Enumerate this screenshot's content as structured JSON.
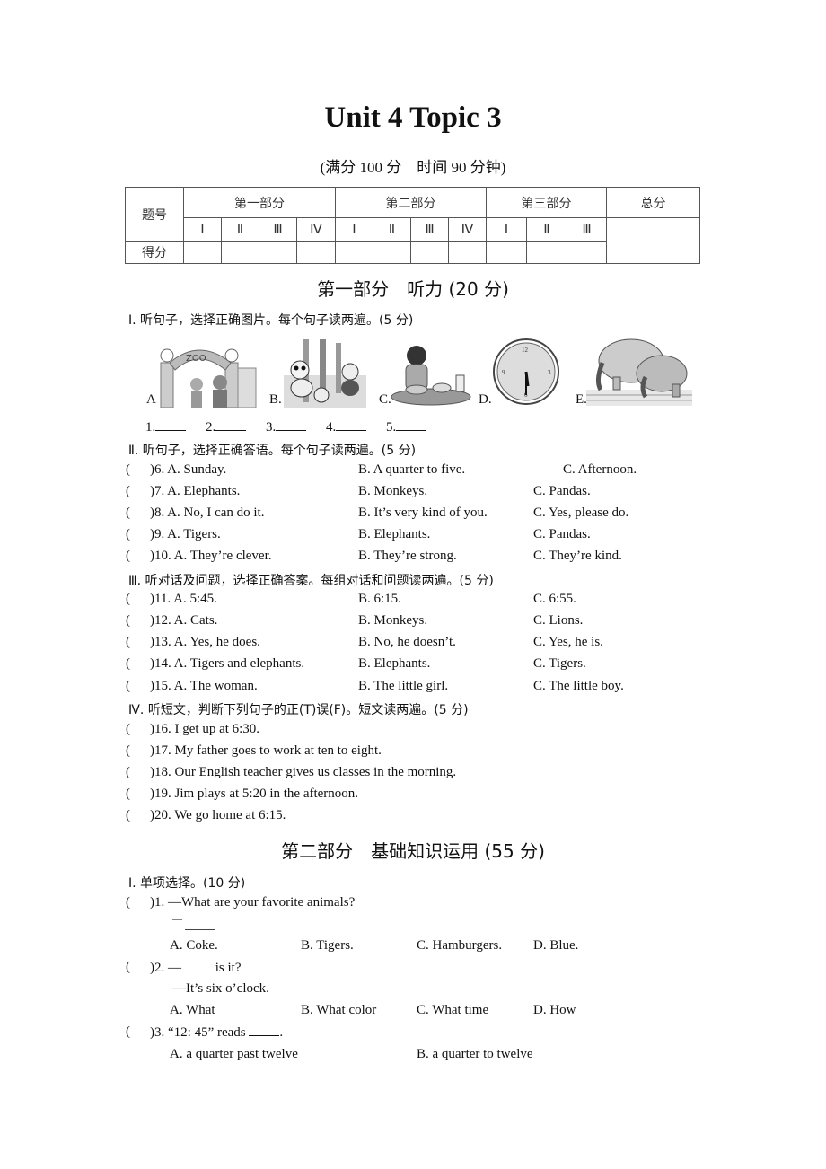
{
  "title": "Unit 4 Topic 3",
  "subtitle": "(满分 100 分　时间 90 分钟)",
  "score_table": {
    "row_header_label": "题号",
    "score_label": "得分",
    "total_label": "总分",
    "parts": [
      {
        "label": "第一部分",
        "columns": [
          "Ⅰ",
          "Ⅱ",
          "Ⅲ",
          "Ⅳ"
        ]
      },
      {
        "label": "第二部分",
        "columns": [
          "Ⅰ",
          "Ⅱ",
          "Ⅲ",
          "Ⅳ"
        ]
      },
      {
        "label": "第三部分",
        "columns": [
          "Ⅰ",
          "Ⅱ",
          "Ⅲ"
        ]
      }
    ]
  },
  "part1": {
    "heading": "第一部分　听力 (20 分)",
    "section1": {
      "instruction": "Ⅰ. 听句子，选择正确图片。每个句子读两遍。(5 分)",
      "pictures": [
        {
          "label": "A.",
          "icon": "zoo-gate-picture"
        },
        {
          "label": "B.",
          "icon": "pandas-picture"
        },
        {
          "label": "C.",
          "icon": "boy-eating-picture"
        },
        {
          "label": "D.",
          "icon": "clock-picture"
        },
        {
          "label": "E.",
          "icon": "elephants-picture"
        }
      ],
      "answer_blanks": [
        "1.",
        "2.",
        "3.",
        "4.",
        "5."
      ]
    },
    "section2": {
      "instruction": "Ⅱ. 听句子，选择正确答语。每个句子读两遍。(5 分)",
      "questions": [
        {
          "num": ")6. A. Sunday.",
          "b": "B. A quarter to five.",
          "c": "C. Afternoon."
        },
        {
          "num": ")7. A. Elephants.",
          "b": "B. Monkeys.",
          "c": "C. Pandas."
        },
        {
          "num": ")8. A. No, I can do it.",
          "b": "B. It’s very kind of you.",
          "c": "C. Yes, please do."
        },
        {
          "num": ")9. A. Tigers.",
          "b": "B. Elephants.",
          "c": "C. Pandas."
        },
        {
          "num": ")10. A. They’re clever.",
          "b": "B. They’re strong.",
          "c": "C. They’re kind."
        }
      ]
    },
    "section3": {
      "instruction": "Ⅲ. 听对话及问题，选择正确答案。每组对话和问题读两遍。(5 分)",
      "questions": [
        {
          "num": ")11. A. 5:45.",
          "b": "B. 6:15.",
          "c": "C. 6:55."
        },
        {
          "num": ")12. A. Cats.",
          "b": "B. Monkeys.",
          "c": "C. Lions."
        },
        {
          "num": ")13. A. Yes, he does.",
          "b": "B. No, he doesn’t.",
          "c": "C. Yes, he is."
        },
        {
          "num": ")14. A. Tigers and elephants.",
          "b": "B. Elephants.",
          "c": "C. Tigers."
        },
        {
          "num": ")15. A. The woman.",
          "b": "B. The little girl.",
          "c": "C. The little boy."
        }
      ]
    },
    "section4": {
      "instruction": "Ⅳ. 听短文，判断下列句子的正(T)误(F)。短文读两遍。(5 分)",
      "statements": [
        ")16. I get up at 6:30.",
        ")17. My father goes to work at ten to eight.",
        ")18. Our English teacher gives us classes in the morning.",
        ")19. Jim plays at 5:20 in the afternoon.",
        ")20. We go home at 6:15."
      ]
    }
  },
  "part2": {
    "heading": "第二部分　基础知识运用 (55 分)",
    "section1": {
      "instruction": "Ⅰ. 单项选择。(10 分)",
      "q1": {
        "stem": ")1. —What are your favorite animals?",
        "reply": "—",
        "options": [
          "A. Coke.",
          "B. Tigers.",
          "C. Hamburgers.",
          "D. Blue."
        ]
      },
      "q2": {
        "stem_prefix": ")2. —",
        "stem_suffix": " is it?",
        "reply": "—It’s six o’clock.",
        "options": [
          "A. What",
          "B. What color",
          "C. What time",
          "D. How"
        ]
      },
      "q3": {
        "stem_prefix": ")3. “12: 45” reads ",
        "stem_suffix": ".",
        "options": [
          "A. a quarter past twelve",
          "B. a quarter to twelve"
        ]
      }
    }
  },
  "paren": "("
}
